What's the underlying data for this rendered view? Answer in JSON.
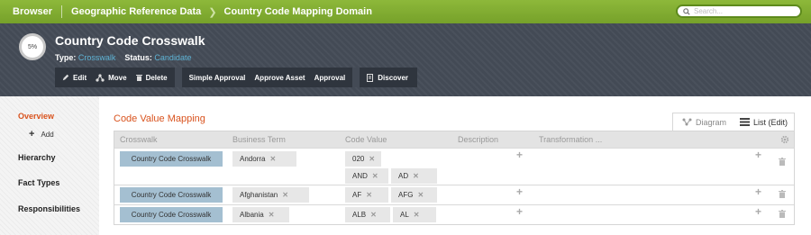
{
  "topbar": {
    "browser": "Browser",
    "crumb1": "Geographic Reference Data",
    "crumb2": "Country Code Mapping Domain",
    "search_placeholder": "Search..."
  },
  "asset": {
    "progress": "5%",
    "title": "Country Code Crosswalk",
    "type_label": "Type:",
    "type_value": "Crosswalk",
    "status_label": "Status:",
    "status_value": "Candidate",
    "actions": [
      "Edit",
      "Move",
      "Delete",
      "Simple Approval",
      "Approve Asset",
      "Approval",
      "Discover"
    ]
  },
  "sidebar": {
    "overview": "Overview",
    "add": "Add",
    "hierarchy": "Hierarchy",
    "fact_types": "Fact Types",
    "responsibilities": "Responsibilities"
  },
  "main": {
    "section_title": "Code Value Mapping",
    "view_diagram": "Diagram",
    "view_list": "List (Edit)",
    "columns": [
      "Crosswalk",
      "Business Term",
      "Code Value",
      "Description",
      "Transformation ..."
    ],
    "rows": [
      {
        "crosswalk": "Country Code Crosswalk",
        "term": "Andorra",
        "codes": [
          "020",
          "AND",
          "AD"
        ]
      },
      {
        "crosswalk": "Country Code Crosswalk",
        "term": "Afghanistan",
        "codes": [
          "AF",
          "AFG"
        ]
      },
      {
        "crosswalk": "Country Code Crosswalk",
        "term": "Albania",
        "codes": [
          "ALB",
          "AL"
        ]
      }
    ]
  },
  "colors": {
    "topbar": "#7fae2f",
    "header": "#434a55",
    "accent": "#d9531e",
    "crosswalk_chip": "#a4bfd1"
  }
}
